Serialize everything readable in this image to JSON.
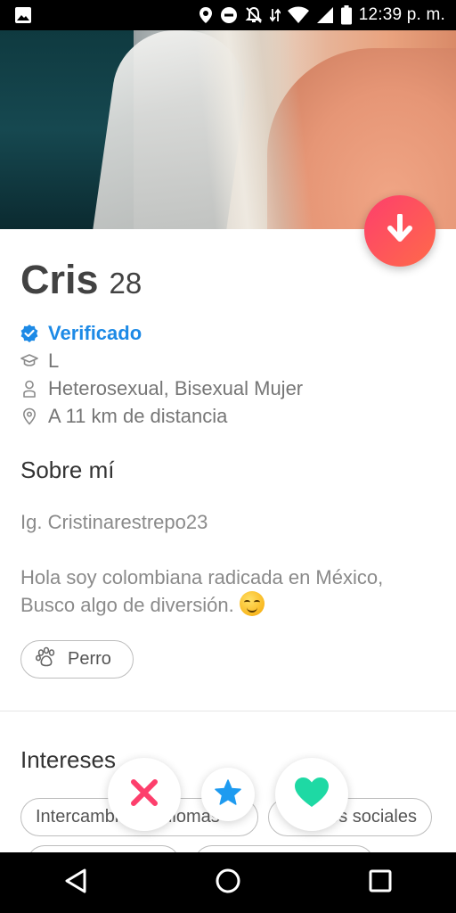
{
  "status_bar": {
    "time": "12:39 p. m.",
    "icons": [
      "image-icon",
      "location-icon",
      "do-not-disturb-icon",
      "notifications-off-icon",
      "data-icon",
      "wifi-icon",
      "signal-icon",
      "battery-icon"
    ]
  },
  "profile": {
    "name": "Cris",
    "age": "28",
    "verified_label": "Verificado",
    "school": "L",
    "orientation": "Heterosexual, Bisexual Mujer",
    "distance": "A 11 km de distancia"
  },
  "about": {
    "title": "Sobre mí",
    "line1": "Ig. Cristinarestrepo23",
    "line2": "Hola soy colombiana radicada en México, Busco algo de diversión."
  },
  "pets": {
    "label": "Perro"
  },
  "interests": {
    "title": "Intereses",
    "items": [
      "Intercambio de idiomas",
      "Redes sociales"
    ]
  },
  "colors": {
    "accent": "#fd3f6c",
    "verified": "#1d8ae6",
    "nope": "#fd3f6c",
    "super_like": "#1e9bf0",
    "like": "#1ed9a4"
  }
}
